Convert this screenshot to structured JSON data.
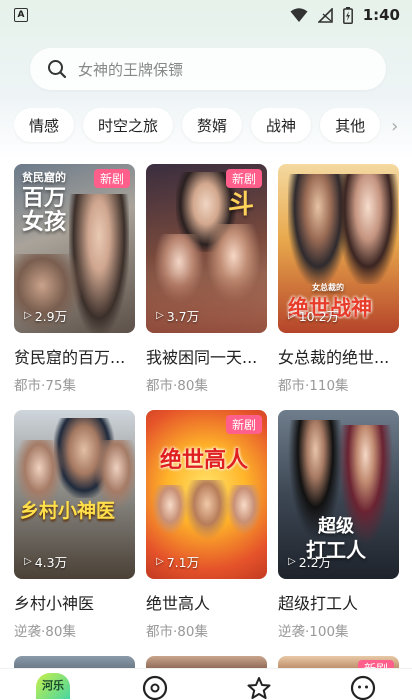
{
  "status_bar": {
    "time": "1:40",
    "app_badge": "A"
  },
  "search": {
    "placeholder": "女神的王牌保镖"
  },
  "tags": [
    "情感",
    "时空之旅",
    "赘婿",
    "战神",
    "其他"
  ],
  "dramas": [
    {
      "title": "贫民窟的百万...",
      "genre_episodes": "都市·75集",
      "views": "2.9万",
      "badge": "新剧",
      "poster_text": "贫民窟的百万女孩"
    },
    {
      "title": "我被困同一天...",
      "genre_episodes": "都市·80集",
      "views": "3.7万",
      "badge": "新剧",
      "poster_text": "斗"
    },
    {
      "title": "女总裁的绝世...",
      "genre_episodes": "都市·110集",
      "views": "10.2万",
      "badge": "",
      "poster_text": "绝世战神"
    },
    {
      "title": "乡村小神医",
      "genre_episodes": "逆袭·80集",
      "views": "4.3万",
      "badge": "",
      "poster_text": "乡村小神医"
    },
    {
      "title": "绝世高人",
      "genre_episodes": "都市·80集",
      "views": "7.1万",
      "badge": "新剧",
      "poster_text": "绝世高人"
    },
    {
      "title": "超级打工人",
      "genre_episodes": "逆袭·100集",
      "views": "2.2万",
      "badge": "",
      "poster_text": "超级打工人"
    }
  ],
  "row3_badge": "新剧",
  "bottom_nav": {
    "logo_text": "河乐"
  },
  "colors": {
    "accent_badge": "#ff5f8a",
    "background_gradient": "#e6f2ea"
  },
  "icons": [
    "search-icon",
    "wifi-icon",
    "signal-off-icon",
    "battery-icon",
    "play-icon",
    "chevron-right-icon",
    "compass-icon",
    "star-icon",
    "profile-icon"
  ]
}
